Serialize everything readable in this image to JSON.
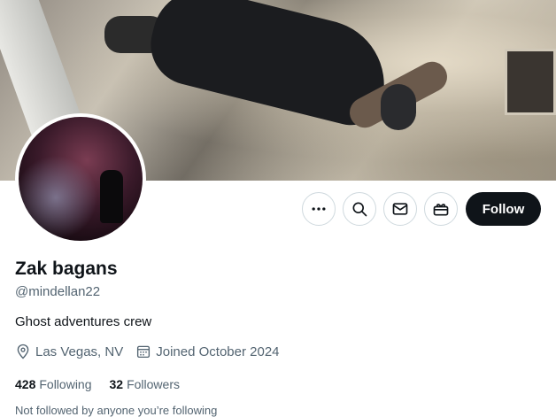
{
  "profile": {
    "display_name": "Zak bagans",
    "handle": "@mindellan22",
    "bio": "Ghost adventures crew",
    "location": "Las Vegas, NV",
    "joined": "Joined October 2024"
  },
  "stats": {
    "following_count": "428",
    "following_label": "Following",
    "followers_count": "32",
    "followers_label": "Followers"
  },
  "actions": {
    "follow_label": "Follow",
    "icons": [
      "more-icon",
      "search-icon",
      "mail-icon",
      "subscribe-icon"
    ]
  },
  "social_context": "Not followed by anyone you’re following",
  "colors": {
    "primary_text": "#0f1419",
    "secondary_text": "#536471",
    "follow_button_bg": "#0f1419",
    "border": "#cfd9de"
  }
}
